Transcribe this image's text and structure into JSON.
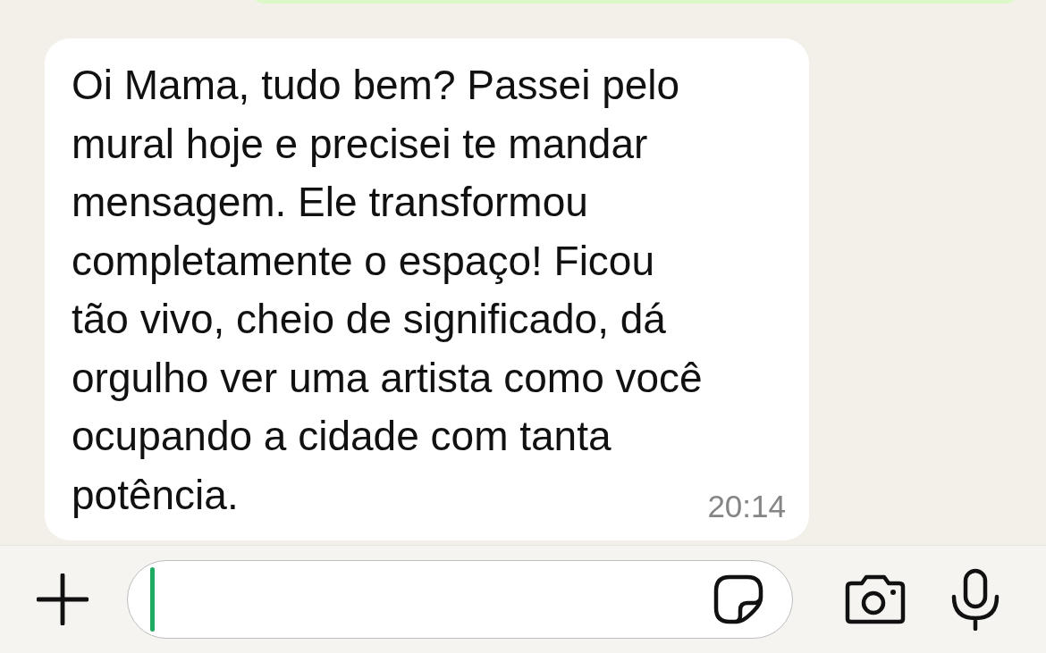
{
  "messages": [
    {
      "kind": "outgoing"
    },
    {
      "kind": "incoming",
      "lines": [
        "Oi Mama, tudo bem? Passei pelo",
        "mural hoje e precisei te mandar",
        "mensagem. Ele transformou",
        "completamente o espaço! Ficou",
        "tão vivo, cheio de significado, dá",
        "orgulho ver uma artista como você",
        "ocupando a cidade com tanta",
        "potência."
      ],
      "time": "20:14"
    }
  ]
}
